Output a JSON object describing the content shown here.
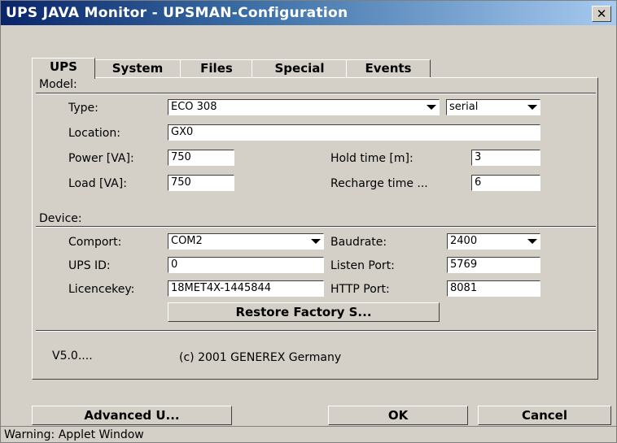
{
  "window": {
    "title": "UPS JAVA Monitor - UPSMAN-Configuration",
    "close_label": "✕"
  },
  "tabs": [
    {
      "label": "UPS"
    },
    {
      "label": "System"
    },
    {
      "label": "Files"
    },
    {
      "label": "Special"
    },
    {
      "label": "Events"
    }
  ],
  "model": {
    "heading": "Model:",
    "type_label": "Type:",
    "type_value": "ECO 308",
    "connection_value": "serial",
    "location_label": "Location:",
    "location_value": "GX0",
    "power_label": "Power [VA]:",
    "power_value": "750",
    "load_label": "Load [VA]:",
    "load_value": "750",
    "hold_time_label": "Hold time [m]:",
    "hold_time_value": "3",
    "recharge_label": "Recharge time ...",
    "recharge_value": "6"
  },
  "device": {
    "heading": "Device:",
    "comport_label": "Comport:",
    "comport_value": "COM2",
    "baudrate_label": "Baudrate:",
    "baudrate_value": "2400",
    "upsid_label": "UPS ID:",
    "upsid_value": "0",
    "listen_port_label": "Listen Port:",
    "listen_port_value": "5769",
    "licence_label": "Licencekey:",
    "licence_value": "18MET4X-1445844",
    "http_port_label": "HTTP Port:",
    "http_port_value": "8081",
    "restore_label": "Restore Factory S..."
  },
  "footer": {
    "version": "V5.0....",
    "copyright": "(c) 2001 GENEREX Germany"
  },
  "buttons": {
    "advanced": "Advanced U...",
    "ok": "OK",
    "cancel": "Cancel"
  },
  "status_bar": "Warning: Applet Window"
}
